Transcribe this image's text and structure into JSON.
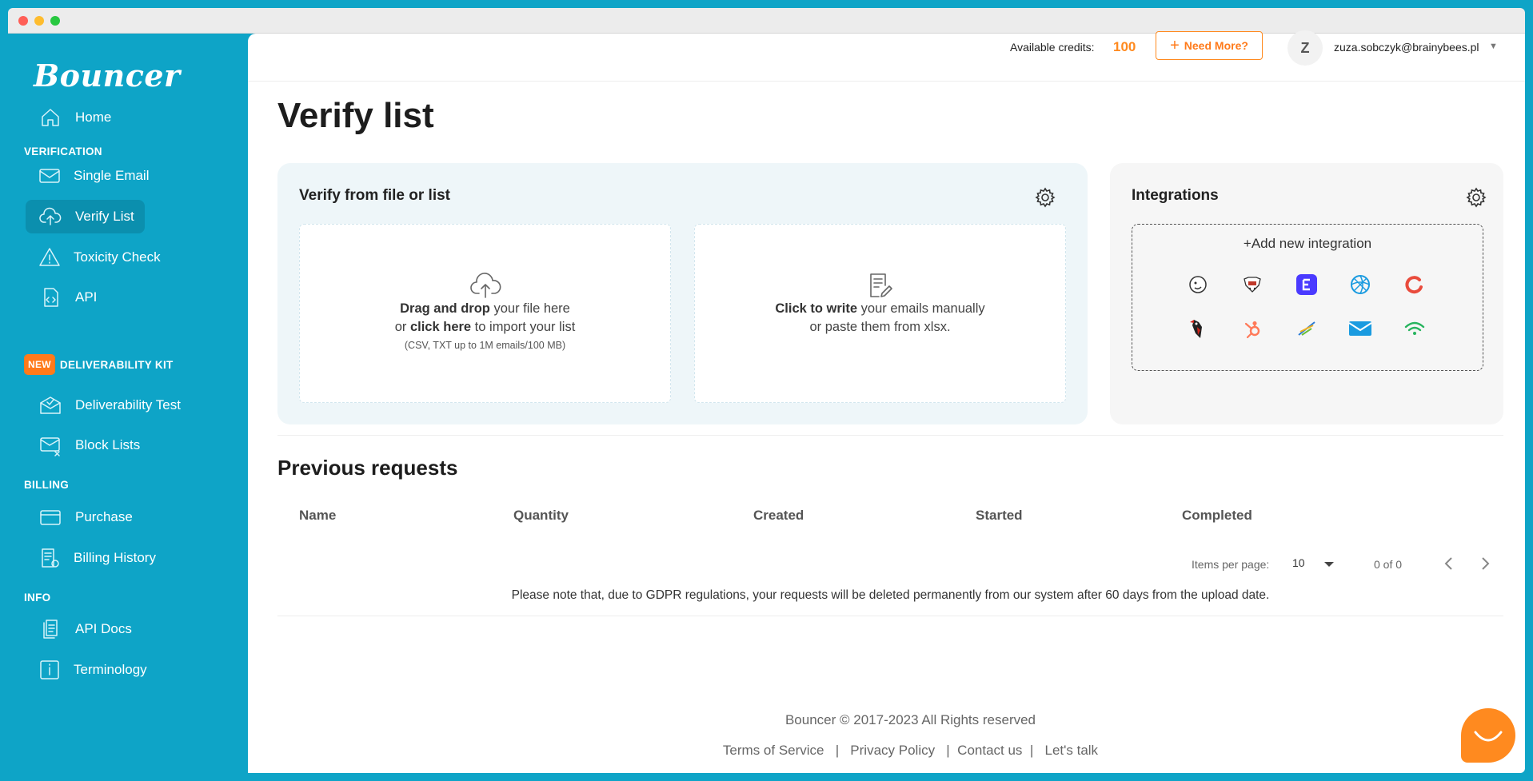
{
  "app": {
    "logo": "Bouncer"
  },
  "sidebar": {
    "items": [
      {
        "label": "Home"
      },
      {
        "label": "Single Email"
      },
      {
        "label": "Verify List"
      },
      {
        "label": "Toxicity Check"
      },
      {
        "label": "API"
      },
      {
        "label": "Deliverability Test"
      },
      {
        "label": "Block Lists"
      },
      {
        "label": "Purchase"
      },
      {
        "label": "Billing History"
      },
      {
        "label": "API Docs"
      },
      {
        "label": "Terminology"
      }
    ],
    "sections": {
      "verification": "VERIFICATION",
      "deliverability": "DELIVERABILITY KIT",
      "new_badge": "NEW",
      "billing": "BILLING",
      "info": "INFO"
    },
    "active_item": "Verify List"
  },
  "topbar": {
    "credits_label": "Available credits:",
    "credits_value": "100",
    "need_more": "Need More?",
    "avatar_initial": "Z",
    "user_email": "zuza.sobczyk@brainybees.pl"
  },
  "page": {
    "title": "Verify list",
    "verify_card": {
      "title": "Verify from file or list",
      "upload": {
        "line1_bold": "Drag and drop",
        "line1_rest": " your file here",
        "line2_pre": "or ",
        "line2_bold": "click here",
        "line2_rest": " to import your list",
        "note": "(CSV, TXT up to 1M emails/100 MB)"
      },
      "manual": {
        "line1_bold": "Click to write",
        "line1_rest": " your emails manually",
        "line2": "or paste them from xlsx."
      }
    },
    "integrations": {
      "title": "Integrations",
      "add_label": "Add new integration",
      "logos": [
        "mailchimp-icon",
        "sendy-icon",
        "elastic-email-icon",
        "sendinblue-icon",
        "activecampaign-icon",
        "woodpecker-icon",
        "hubspot-icon",
        "zapier-icon",
        "mailerlite-icon",
        "wifi-icon"
      ]
    },
    "previous": {
      "title": "Previous requests",
      "columns": [
        "Name",
        "Quantity",
        "Created",
        "Started",
        "Completed"
      ],
      "items_per_page_label": "Items per page:",
      "items_per_page_value": "10",
      "range": "0 of 0",
      "gdpr_note": "Please note that, due to GDPR regulations, your requests will be deleted permanently from our system after 60 days from the upload date."
    }
  },
  "footer": {
    "copyright": "Bouncer © 2017-2023 All Rights reserved",
    "links": [
      "Terms of Service",
      "Privacy Policy",
      "Contact us",
      "Let's talk"
    ]
  },
  "colors": {
    "brand": "#0ea4c7",
    "accent": "#ff8a1f"
  }
}
